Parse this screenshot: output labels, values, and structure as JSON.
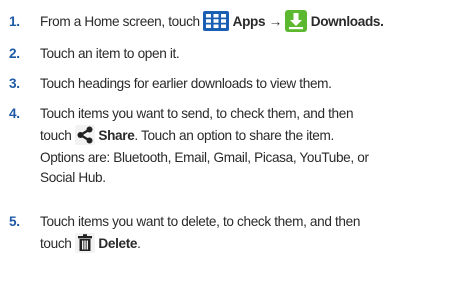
{
  "steps": [
    {
      "number": "1.",
      "text_1": "From a Home screen, touch",
      "apps_label": "Apps",
      "arrow": "→",
      "downloads_label": "Downloads.",
      "apps_icon": "apps-grid-icon",
      "downloads_icon": "download-arrow-icon"
    },
    {
      "number": "2.",
      "text": "Touch an item to open it."
    },
    {
      "number": "3.",
      "text": "Touch headings for earlier downloads to view them."
    },
    {
      "number": "4.",
      "line_1": "Touch items you want to send, to check them, and then",
      "line_2_prefix": "touch",
      "share_label": "Share",
      "line_2_suffix": ". Touch an option to share the item.",
      "line_3": "Options are: Bluetooth, Email, Gmail, Picasa, YouTube, or",
      "line_4": "Social Hub.",
      "share_icon": "share-icon"
    },
    {
      "number": "5.",
      "line_1": "Touch items you want to delete, to check them, and then",
      "line_2_prefix": "touch",
      "delete_label": "Delete",
      "line_2_suffix": ".",
      "delete_icon": "trash-icon"
    }
  ],
  "colors": {
    "step_number": "#1f5aa6",
    "body_text": "#2a2a2a",
    "apps_icon_bg": "#1a5fb4",
    "downloads_icon_bg": "#5cb82e"
  }
}
